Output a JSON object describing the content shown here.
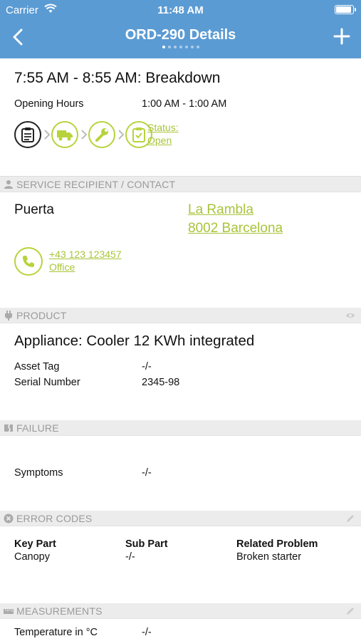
{
  "status_bar": {
    "carrier": "Carrier",
    "time": "11:48 AM"
  },
  "nav": {
    "title": "ORD-290 Details",
    "page_dots": 7,
    "active_dot": 0
  },
  "order": {
    "time_range": "7:55 AM - 8:55 AM: Breakdown",
    "opening_hours_label": "Opening Hours",
    "opening_hours_value": "1:00 AM - 1:00 AM",
    "workflow_icons": [
      "clipboard-icon",
      "truck-icon",
      "wrench-icon",
      "checklist-icon"
    ],
    "status_line1": "Status:",
    "status_line2": "Open"
  },
  "service_recipient": {
    "header": "SERVICE RECIPIENT / CONTACT",
    "name": "Puerta",
    "address_line1": "La Rambla",
    "address_line2": "8002 Barcelona",
    "phone": "+43 123 123457",
    "phone_type": "Office"
  },
  "product": {
    "header": "PRODUCT",
    "title": "Appliance: Cooler 12 KWh integrated",
    "asset_tag_label": "Asset Tag",
    "asset_tag_value": "-/-",
    "serial_label": "Serial Number",
    "serial_value": "2345-98"
  },
  "failure": {
    "header": "FAILURE",
    "symptoms_label": "Symptoms",
    "symptoms_value": "-/-"
  },
  "error_codes": {
    "header": "ERROR CODES",
    "columns": [
      "Key Part",
      "Sub Part",
      "Related Problem"
    ],
    "rows": [
      [
        "Canopy",
        "-/-",
        "Broken starter"
      ]
    ]
  },
  "measurements": {
    "header": "MEASUREMENTS",
    "temperature_label": "Temperature in °C",
    "temperature_value": "-/-"
  },
  "colors": {
    "nav": "#5b9bd3",
    "accent": "#a8c43a",
    "section_bg": "#ececec"
  }
}
